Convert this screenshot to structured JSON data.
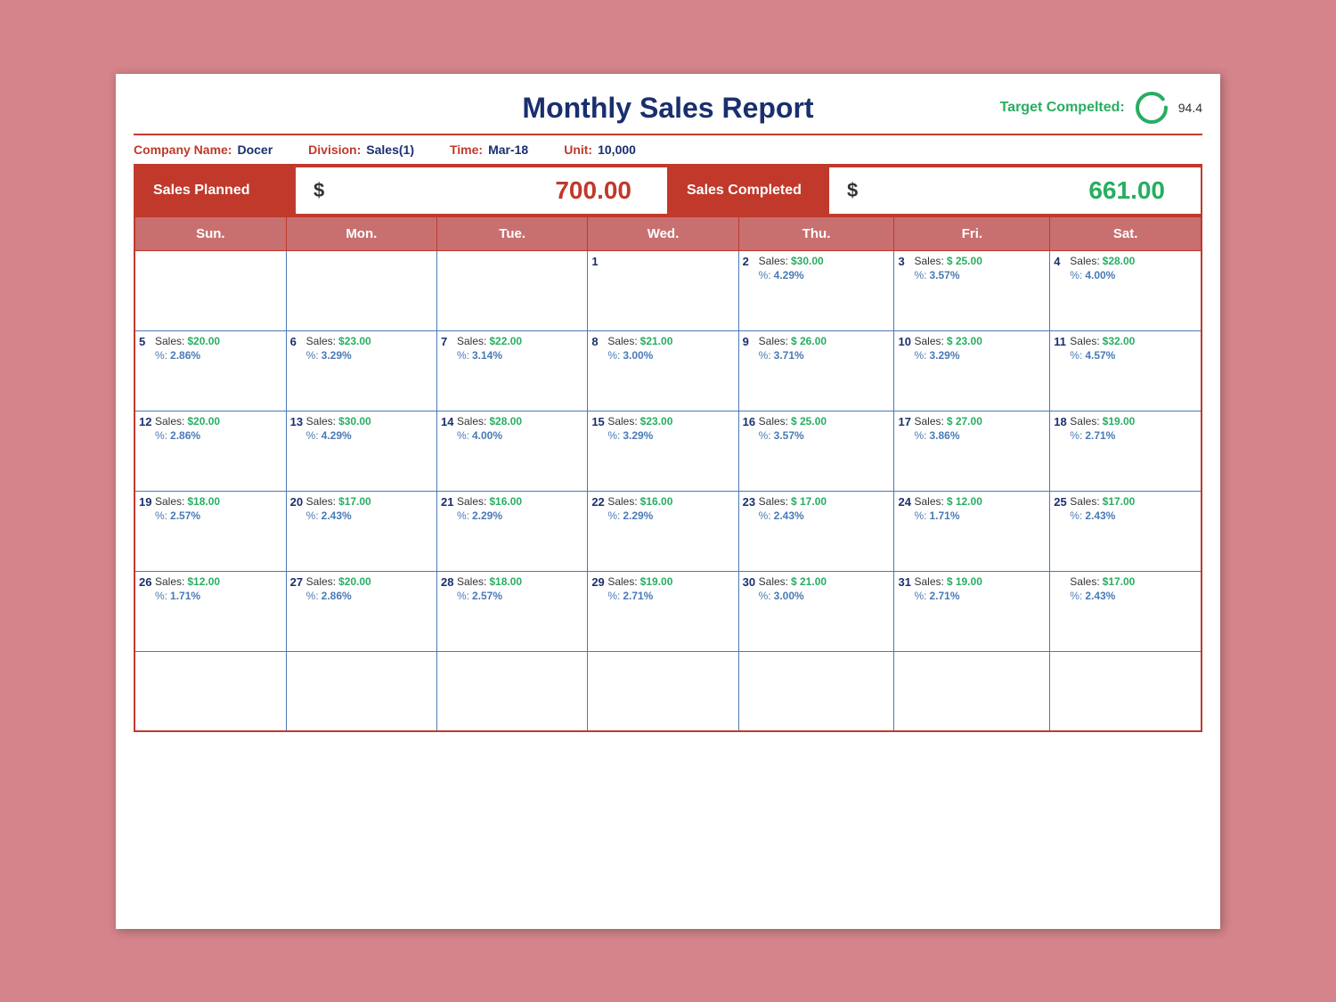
{
  "header": {
    "title": "Monthly Sales Report",
    "target_label": "Target Compelted:",
    "target_value": "94.4"
  },
  "info": {
    "company_label": "Company Name:",
    "company_value": "Docer",
    "division_label": "Division:",
    "division_value": "Sales(1)",
    "time_label": "Time:",
    "time_value": "Mar-18",
    "unit_label": "Unit:",
    "unit_value": "10,000"
  },
  "totals": {
    "planned_label": "Sales Planned",
    "planned_dollar": "$",
    "planned_amount": "700.00",
    "completed_label": "Sales Completed",
    "completed_dollar": "$",
    "completed_amount": "661.00"
  },
  "days_header": [
    "Sun.",
    "Mon.",
    "Tue.",
    "Wed.",
    "Thu.",
    "Fri.",
    "Sat."
  ],
  "weeks": [
    [
      {
        "day": null,
        "sales": null,
        "pct": null
      },
      {
        "day": null,
        "sales": null,
        "pct": null
      },
      {
        "day": null,
        "sales": null,
        "pct": null
      },
      {
        "day": "1",
        "sales": null,
        "pct": null
      },
      {
        "day": "2",
        "sales": "$30.00",
        "pct": "4.29%"
      },
      {
        "day": "3",
        "sales": "$ 25.00",
        "pct": "3.57%"
      },
      {
        "day": "4",
        "sales": "$28.00",
        "pct": "4.00%"
      }
    ],
    [
      {
        "day": "5",
        "sales": "$20.00",
        "pct": "2.86%"
      },
      {
        "day": "6",
        "sales": "$23.00",
        "pct": "3.29%"
      },
      {
        "day": "7",
        "sales": "$22.00",
        "pct": "3.14%"
      },
      {
        "day": "8",
        "sales": "$21.00",
        "pct": "3.00%"
      },
      {
        "day": "9",
        "sales": "$ 26.00",
        "pct": "3.71%"
      },
      {
        "day": "10",
        "sales": "$ 23.00",
        "pct": "3.29%"
      },
      {
        "day": "11",
        "sales": "$32.00",
        "pct": "4.57%"
      }
    ],
    [
      {
        "day": "12",
        "sales": "$20.00",
        "pct": "2.86%"
      },
      {
        "day": "13",
        "sales": "$30.00",
        "pct": "4.29%"
      },
      {
        "day": "14",
        "sales": "$28.00",
        "pct": "4.00%"
      },
      {
        "day": "15",
        "sales": "$23.00",
        "pct": "3.29%"
      },
      {
        "day": "16",
        "sales": "$ 25.00",
        "pct": "3.57%"
      },
      {
        "day": "17",
        "sales": "$ 27.00",
        "pct": "3.86%"
      },
      {
        "day": "18",
        "sales": "$19.00",
        "pct": "2.71%"
      }
    ],
    [
      {
        "day": "19",
        "sales": "$18.00",
        "pct": "2.57%"
      },
      {
        "day": "20",
        "sales": "$17.00",
        "pct": "2.43%"
      },
      {
        "day": "21",
        "sales": "$16.00",
        "pct": "2.29%"
      },
      {
        "day": "22",
        "sales": "$16.00",
        "pct": "2.29%"
      },
      {
        "day": "23",
        "sales": "$ 17.00",
        "pct": "2.43%"
      },
      {
        "day": "24",
        "sales": "$ 12.00",
        "pct": "1.71%"
      },
      {
        "day": "25",
        "sales": "$17.00",
        "pct": "2.43%"
      }
    ],
    [
      {
        "day": "26",
        "sales": "$12.00",
        "pct": "1.71%"
      },
      {
        "day": "27",
        "sales": "$20.00",
        "pct": "2.86%"
      },
      {
        "day": "28",
        "sales": "$18.00",
        "pct": "2.57%"
      },
      {
        "day": "29",
        "sales": "$19.00",
        "pct": "2.71%"
      },
      {
        "day": "30",
        "sales": "$ 21.00",
        "pct": "3.00%"
      },
      {
        "day": "31",
        "sales": "$ 19.00",
        "pct": "2.71%"
      },
      {
        "day": null,
        "sales": "$17.00",
        "pct": "2.43%"
      }
    ],
    [
      {
        "day": null,
        "sales": null,
        "pct": null
      },
      {
        "day": null,
        "sales": null,
        "pct": null
      },
      {
        "day": null,
        "sales": null,
        "pct": null
      },
      {
        "day": null,
        "sales": null,
        "pct": null
      },
      {
        "day": null,
        "sales": null,
        "pct": null
      },
      {
        "day": null,
        "sales": null,
        "pct": null
      },
      {
        "day": null,
        "sales": null,
        "pct": null
      }
    ]
  ]
}
